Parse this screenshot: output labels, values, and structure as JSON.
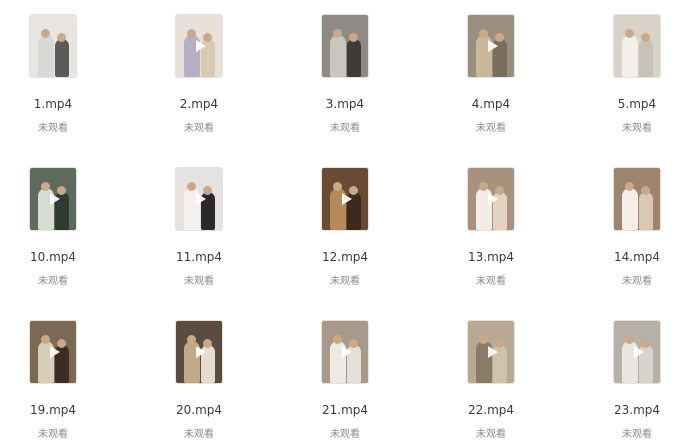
{
  "files": [
    {
      "name": "1.mp4",
      "status": "未观看",
      "play": false,
      "bg": "#e9e6e2",
      "c1": "#d8d8d8",
      "c2": "#5b5b5b"
    },
    {
      "name": "2.mp4",
      "status": "未观看",
      "play": true,
      "bg": "#e9e1d8",
      "c1": "#b6b0c4",
      "c2": "#d8c9b1"
    },
    {
      "name": "3.mp4",
      "status": "未观看",
      "play": false,
      "bg": "#8f8a83",
      "c1": "#c9c6c0",
      "c2": "#3f3b36"
    },
    {
      "name": "4.mp4",
      "status": "未观看",
      "play": true,
      "bg": "#9a8e7c",
      "c1": "#c9b89a",
      "c2": "#7a6d5c"
    },
    {
      "name": "5.mp4",
      "status": "未观看",
      "play": false,
      "bg": "#d9d2c8",
      "c1": "#f2f0ea",
      "c2": "#c7c2b8"
    },
    {
      "name": "10.mp4",
      "status": "未观看",
      "play": true,
      "bg": "#5d6a5e",
      "c1": "#d7dcd2",
      "c2": "#2f3a30"
    },
    {
      "name": "11.mp4",
      "status": "未观看",
      "play": true,
      "bg": "#e6e2e0",
      "c1": "#f3f1f0",
      "c2": "#2a2a2a"
    },
    {
      "name": "12.mp4",
      "status": "未观看",
      "play": true,
      "bg": "#6a4a32",
      "c1": "#b58a5a",
      "c2": "#3a2a20"
    },
    {
      "name": "13.mp4",
      "status": "未观看",
      "play": true,
      "bg": "#a8927c",
      "c1": "#f1ece6",
      "c2": "#e4d3c2"
    },
    {
      "name": "14.mp4",
      "status": "未观看",
      "play": false,
      "bg": "#9e846c",
      "c1": "#f3efe9",
      "c2": "#d8c8b4"
    },
    {
      "name": "19.mp4",
      "status": "未观看",
      "play": true,
      "bg": "#7a6a52",
      "c1": "#d7cdb8",
      "c2": "#3a2e22"
    },
    {
      "name": "20.mp4",
      "status": "未观看",
      "play": true,
      "bg": "#5a4d40",
      "c1": "#c0a888",
      "c2": "#e6dccd"
    },
    {
      "name": "21.mp4",
      "status": "未观看",
      "play": true,
      "bg": "#a89a8a",
      "c1": "#efe9e4",
      "c2": "#e5dfda"
    },
    {
      "name": "22.mp4",
      "status": "未观看",
      "play": true,
      "bg": "#b9a892",
      "c1": "#8a7a66",
      "c2": "#d0c2ad"
    },
    {
      "name": "23.mp4",
      "status": "未观看",
      "play": true,
      "bg": "#b7b0a6",
      "c1": "#e9e6e0",
      "c2": "#d8d3cb"
    }
  ]
}
